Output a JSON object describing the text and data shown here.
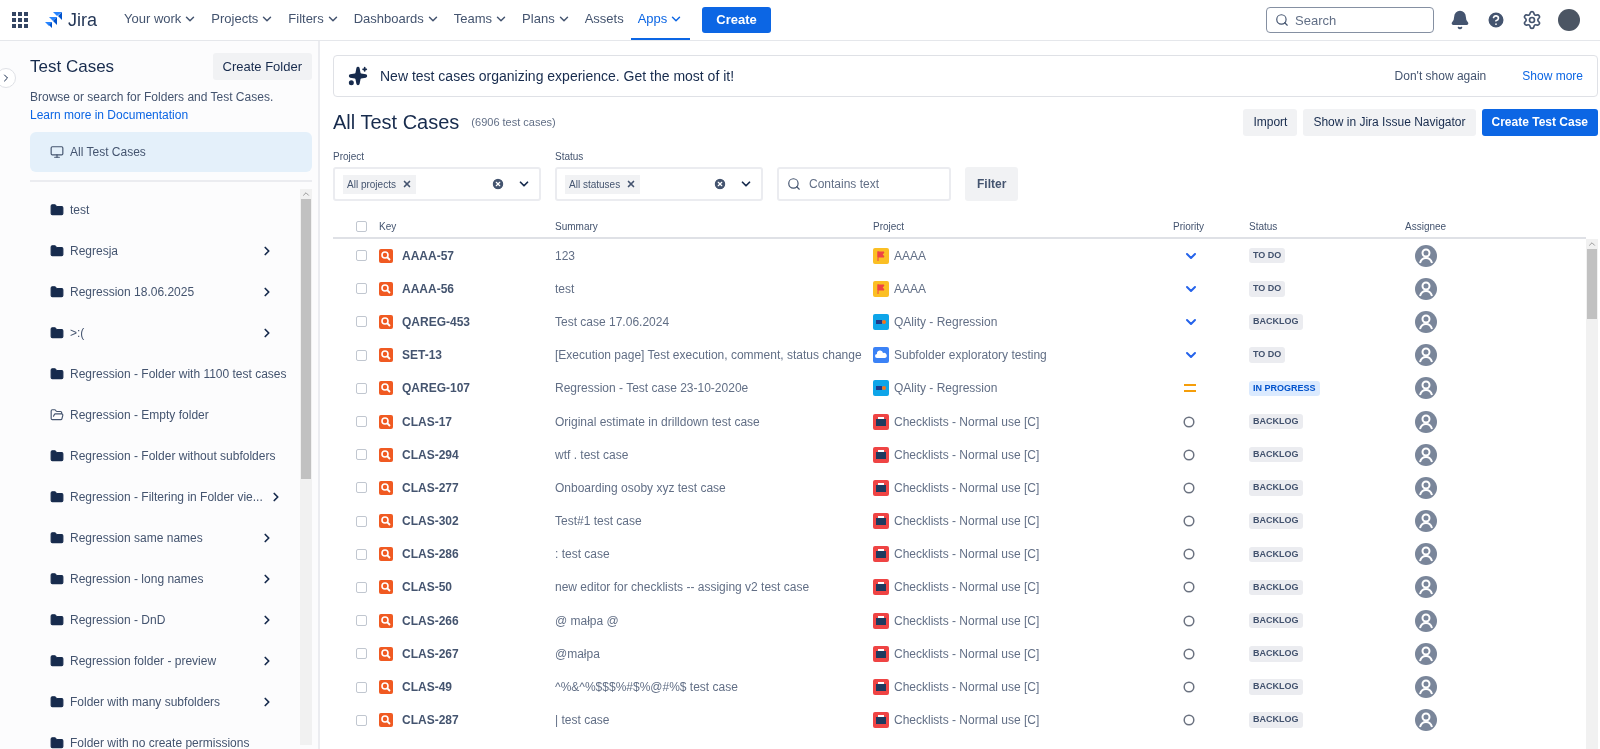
{
  "topbar": {
    "logo": "Jira",
    "nav": [
      {
        "label": "Your work",
        "dropdown": true,
        "selected": false
      },
      {
        "label": "Projects",
        "dropdown": true,
        "selected": false
      },
      {
        "label": "Filters",
        "dropdown": true,
        "selected": false
      },
      {
        "label": "Dashboards",
        "dropdown": true,
        "selected": false
      },
      {
        "label": "Teams",
        "dropdown": true,
        "selected": false
      },
      {
        "label": "Plans",
        "dropdown": true,
        "selected": false
      },
      {
        "label": "Assets",
        "dropdown": false,
        "selected": false
      },
      {
        "label": "Apps",
        "dropdown": true,
        "selected": true
      }
    ],
    "create": "Create",
    "search": {
      "placeholder": "Search"
    }
  },
  "sidebar": {
    "title": "Test Cases",
    "create_folder": "Create Folder",
    "description": "Browse or search for Folders and Test Cases.",
    "doc_link": "Learn more in Documentation",
    "all_item": {
      "label": "All Test Cases",
      "selected": true
    },
    "folders": [
      {
        "label": "test",
        "has_children": false,
        "empty": false
      },
      {
        "label": "Regresja",
        "has_children": true,
        "empty": false
      },
      {
        "label": "Regression 18.06.2025",
        "has_children": true,
        "empty": false
      },
      {
        "label": ">:(",
        "has_children": true,
        "empty": false
      },
      {
        "label": "Regression - Folder with 1100 test cases",
        "has_children": false,
        "empty": false
      },
      {
        "label": "Regression - Empty folder",
        "has_children": false,
        "empty": true
      },
      {
        "label": "Regression - Folder without subfolders",
        "has_children": false,
        "empty": false
      },
      {
        "label": "Regression - Filtering in Folder vie...",
        "has_children": true,
        "empty": false
      },
      {
        "label": "Regression same names",
        "has_children": true,
        "empty": false
      },
      {
        "label": "Regression - long names",
        "has_children": true,
        "empty": false
      },
      {
        "label": "Regression - DnD",
        "has_children": true,
        "empty": false
      },
      {
        "label": "Regression folder - preview",
        "has_children": true,
        "empty": false
      },
      {
        "label": "Folder with many subfolders",
        "has_children": true,
        "empty": false
      },
      {
        "label": "Folder with no create permissions",
        "has_children": false,
        "empty": false
      }
    ]
  },
  "banner": {
    "text": "New test cases organizing experience. Get the most of it!",
    "dismiss": "Don't show again",
    "more": "Show more"
  },
  "header": {
    "title": "All Test Cases",
    "count": "(6906 test cases)",
    "buttons": [
      "Import",
      "Show in Jira Issue Navigator"
    ],
    "primary": "Create Test Case"
  },
  "filters": {
    "project": {
      "label": "Project",
      "tag": "All projects"
    },
    "status": {
      "label": "Status",
      "tag": "All statuses"
    },
    "text": {
      "placeholder": "Contains text"
    },
    "button": "Filter"
  },
  "table": {
    "select_all": {
      "checked": false
    },
    "columns": [
      "Key",
      "Summary",
      "Project",
      "Priority",
      "Status",
      "Assignee"
    ],
    "rows": [
      {
        "checked": false,
        "key": "AAAA-57",
        "summary": "123",
        "project": {
          "name": "AAAA",
          "kind": "flag"
        },
        "priority": {
          "kind": "low"
        },
        "status": {
          "label": "TO DO",
          "kind": "todo"
        }
      },
      {
        "checked": false,
        "key": "AAAA-56",
        "summary": "test",
        "project": {
          "name": "AAAA",
          "kind": "flag"
        },
        "priority": {
          "kind": "low"
        },
        "status": {
          "label": "TO DO",
          "kind": "todo"
        }
      },
      {
        "checked": false,
        "key": "QAREG-453",
        "summary": "Test case 17.06.2024",
        "project": {
          "name": "QAlity - Regression",
          "kind": "device"
        },
        "priority": {
          "kind": "low"
        },
        "status": {
          "label": "BACKLOG",
          "kind": "backlog"
        }
      },
      {
        "checked": false,
        "key": "SET-13",
        "summary": "[Execution page] Test execution, comment, status change",
        "project": {
          "name": "Subfolder exploratory testing",
          "kind": "cloud"
        },
        "priority": {
          "kind": "low"
        },
        "status": {
          "label": "TO DO",
          "kind": "todo"
        }
      },
      {
        "checked": false,
        "key": "QAREG-107",
        "summary": "Regression - Test case 23-10-2020e",
        "project": {
          "name": "QAlity - Regression",
          "kind": "device"
        },
        "priority": {
          "kind": "medium"
        },
        "status": {
          "label": "IN PROGRESS",
          "kind": "progress"
        }
      },
      {
        "checked": false,
        "key": "CLAS-17",
        "summary": "Original estimate in drilldown test case",
        "project": {
          "name": "Checklists - Normal use [C]",
          "kind": "briefcase"
        },
        "priority": {
          "kind": "none"
        },
        "status": {
          "label": "BACKLOG",
          "kind": "backlog"
        }
      },
      {
        "checked": false,
        "key": "CLAS-294",
        "summary": "wtf . test case",
        "project": {
          "name": "Checklists - Normal use [C]",
          "kind": "briefcase"
        },
        "priority": {
          "kind": "none"
        },
        "status": {
          "label": "BACKLOG",
          "kind": "backlog"
        }
      },
      {
        "checked": false,
        "key": "CLAS-277",
        "summary": "Onboarding osoby xyz test case",
        "project": {
          "name": "Checklists - Normal use [C]",
          "kind": "briefcase"
        },
        "priority": {
          "kind": "none"
        },
        "status": {
          "label": "BACKLOG",
          "kind": "backlog"
        }
      },
      {
        "checked": false,
        "key": "CLAS-302",
        "summary": "Test#1 test case",
        "project": {
          "name": "Checklists - Normal use [C]",
          "kind": "briefcase"
        },
        "priority": {
          "kind": "none"
        },
        "status": {
          "label": "BACKLOG",
          "kind": "backlog"
        }
      },
      {
        "checked": false,
        "key": "CLAS-286",
        "summary": ": test case",
        "project": {
          "name": "Checklists - Normal use [C]",
          "kind": "briefcase"
        },
        "priority": {
          "kind": "none"
        },
        "status": {
          "label": "BACKLOG",
          "kind": "backlog"
        }
      },
      {
        "checked": false,
        "key": "CLAS-50",
        "summary": "new editor for checklists -- assiging v2 test case",
        "project": {
          "name": "Checklists - Normal use [C]",
          "kind": "briefcase"
        },
        "priority": {
          "kind": "none"
        },
        "status": {
          "label": "BACKLOG",
          "kind": "backlog"
        }
      },
      {
        "checked": false,
        "key": "CLAS-266",
        "summary": "@ małpa @",
        "project": {
          "name": "Checklists - Normal use [C]",
          "kind": "briefcase"
        },
        "priority": {
          "kind": "none"
        },
        "status": {
          "label": "BACKLOG",
          "kind": "backlog"
        }
      },
      {
        "checked": false,
        "key": "CLAS-267",
        "summary": "@małpa",
        "project": {
          "name": "Checklists - Normal use [C]",
          "kind": "briefcase"
        },
        "priority": {
          "kind": "none"
        },
        "status": {
          "label": "BACKLOG",
          "kind": "backlog"
        }
      },
      {
        "checked": false,
        "key": "CLAS-49",
        "summary": "^%&^%$$$%#$%@#%$ test case",
        "project": {
          "name": "Checklists - Normal use [C]",
          "kind": "briefcase"
        },
        "priority": {
          "kind": "none"
        },
        "status": {
          "label": "BACKLOG",
          "kind": "backlog"
        }
      },
      {
        "checked": false,
        "key": "CLAS-287",
        "summary": "| test case",
        "project": {
          "name": "Checklists - Normal use [C]",
          "kind": "briefcase"
        },
        "priority": {
          "kind": "none"
        },
        "status": {
          "label": "BACKLOG",
          "kind": "backlog"
        }
      }
    ]
  }
}
